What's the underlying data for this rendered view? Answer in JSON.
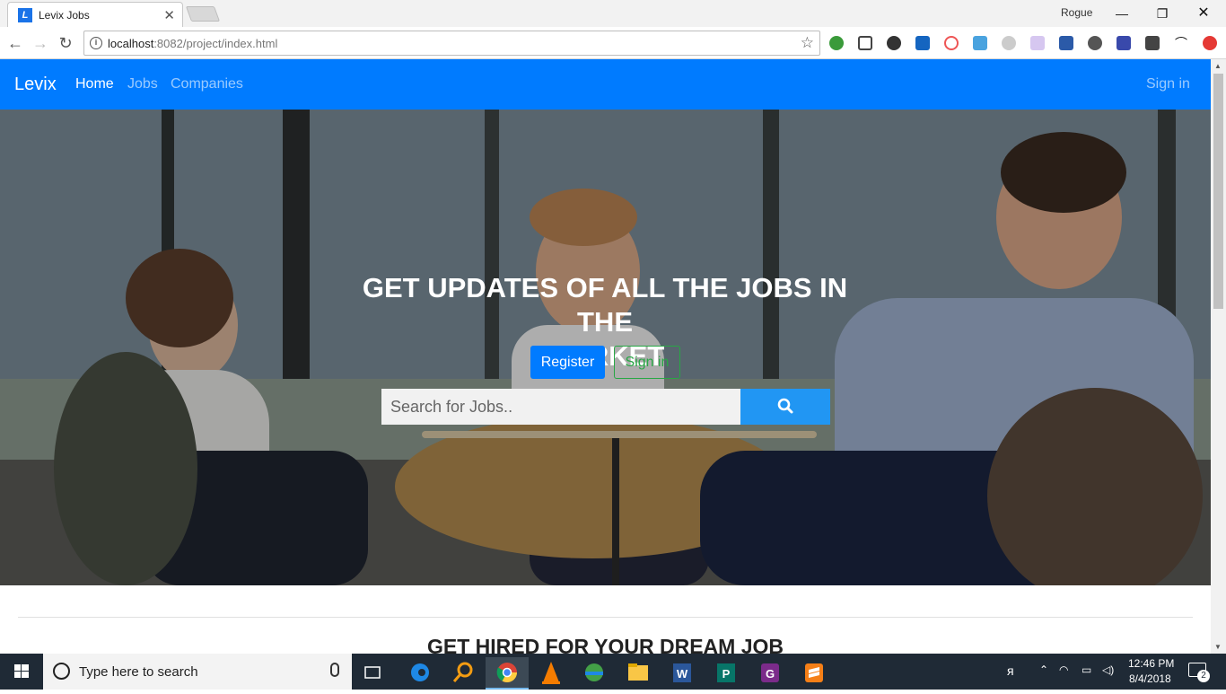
{
  "browser": {
    "tab_title": "Levix Jobs",
    "profile_name": "Rogue",
    "url_host": "localhost",
    "url_path": ":8082/project/index.html"
  },
  "page": {
    "brand": "Levix",
    "nav": {
      "home": "Home",
      "jobs": "Jobs",
      "companies": "Companies",
      "signin": "Sign in"
    },
    "hero": {
      "title_line1": "GET UPDATES OF ALL THE JOBS IN THE",
      "title_line2": "MARKET",
      "register_label": "Register",
      "signin_label": "Sign in",
      "search_placeholder": "Search for Jobs.."
    },
    "section_title": "GET HIRED FOR YOUR DREAM JOB",
    "colors": {
      "navbar": "#007bff",
      "search_button": "#2196f3",
      "signin_outline": "#28a745"
    }
  },
  "taskbar": {
    "search_placeholder": "Type here to search",
    "time": "12:46 PM",
    "date": "8/4/2018",
    "notification_count": "2"
  }
}
